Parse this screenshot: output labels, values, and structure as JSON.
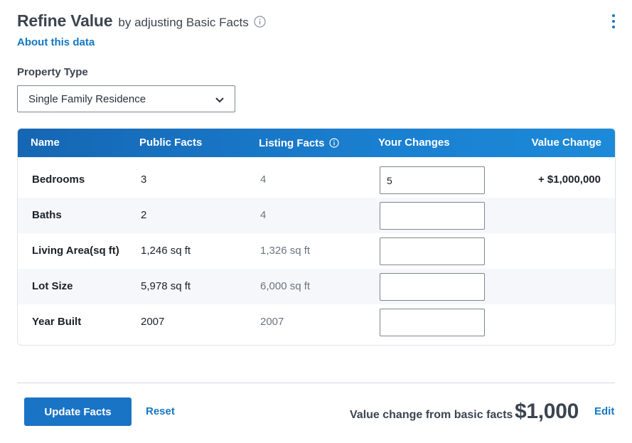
{
  "header": {
    "title": "Refine Value",
    "subtitle": "by adjusting Basic Facts",
    "about_link": "About this data"
  },
  "property_type": {
    "label": "Property Type",
    "selected": "Single Family Residence"
  },
  "table": {
    "columns": [
      "Name",
      "Public Facts",
      "Listing Facts",
      "Your Changes",
      "Value Change"
    ],
    "rows": [
      {
        "name": "Bedrooms",
        "public": "3",
        "listing": "4",
        "change": "5",
        "value_change": "+ $1,000,000"
      },
      {
        "name": "Baths",
        "public": "2",
        "listing": "4",
        "change": "",
        "value_change": ""
      },
      {
        "name": "Living Area(sq ft)",
        "public": "1,246 sq ft",
        "listing": "1,326 sq ft",
        "change": "",
        "value_change": ""
      },
      {
        "name": "Lot Size",
        "public": "5,978 sq ft",
        "listing": "6,000 sq ft",
        "change": "",
        "value_change": ""
      },
      {
        "name": "Year Built",
        "public": "2007",
        "listing": "2007",
        "change": "",
        "value_change": ""
      }
    ]
  },
  "footer": {
    "update_button": "Update Facts",
    "reset_link": "Reset",
    "summary_label": "Value change from basic facts",
    "summary_value": "$1,000",
    "edit_link": "Edit"
  },
  "colors": {
    "accent": "#1478c2",
    "header_bar": "#1a74c6",
    "text_dark": "#3b4450"
  },
  "icons": [
    "info-icon",
    "more-vertical-icon",
    "chevron-down-icon"
  ]
}
